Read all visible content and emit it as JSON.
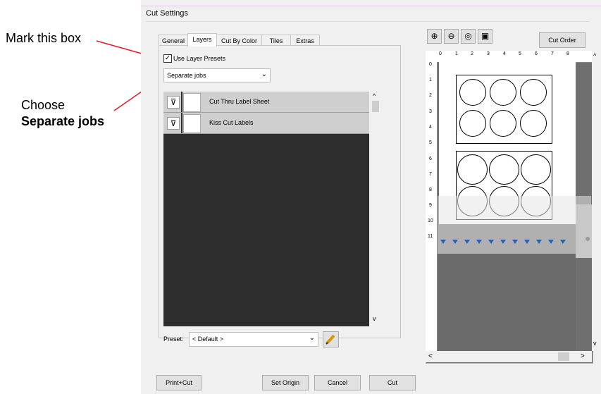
{
  "annotations": {
    "mark_box": "Mark this box",
    "choose_line1": "Choose",
    "choose_line2": "Separate jobs"
  },
  "window": {
    "title": "Cut Settings"
  },
  "tabs": [
    "General",
    "Layers",
    "Cut By Color",
    "Tiles",
    "Extras"
  ],
  "layers_panel": {
    "use_layer_presets_label": "Use Layer Presets",
    "use_layer_presets_checked": true,
    "mode_selected": "Separate jobs",
    "layers": [
      {
        "name": "Cut Thru Label Sheet"
      },
      {
        "name": "Kiss Cut Labels"
      }
    ],
    "preset_label": "Preset:",
    "preset_value": "< Default >"
  },
  "preview": {
    "cut_order_label": "Cut Order",
    "ruler_h_ticks": [
      "0",
      "1",
      "2",
      "3",
      "4",
      "5",
      "6",
      "7",
      "8"
    ],
    "ruler_v_ticks": [
      "0",
      "1",
      "2",
      "3",
      "4",
      "5",
      "6",
      "7",
      "8",
      "9",
      "10",
      "11"
    ]
  },
  "footer": {
    "print_cut": "Print+Cut",
    "set_origin": "Set Origin",
    "cancel": "Cancel",
    "cut": "Cut"
  },
  "colors": {
    "accent_arrow": "#e8182a",
    "direction_marker": "#1f66b0",
    "layer_list_bg": "#2d2d2d"
  }
}
